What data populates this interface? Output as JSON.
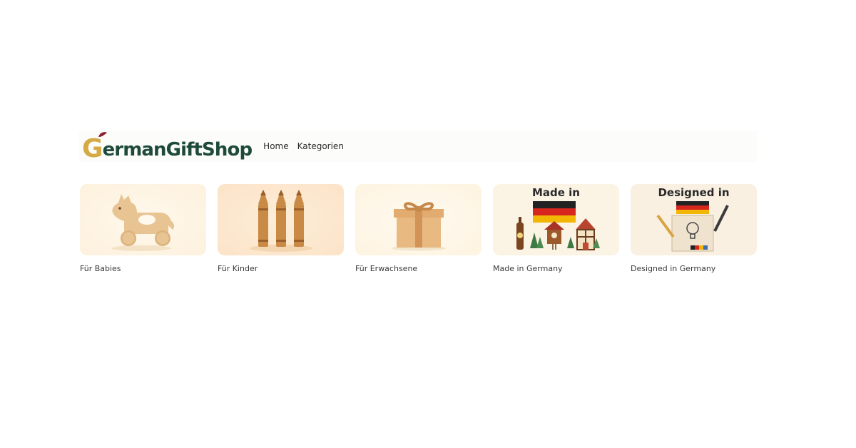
{
  "brand": {
    "logo_initial": "G",
    "logo_rest": "ermanGiftShop"
  },
  "nav": {
    "items": [
      "Home",
      "Kategorien"
    ]
  },
  "categories": [
    {
      "label": "Für Babies",
      "icon": "wooden-horse-icon"
    },
    {
      "label": "Für Kinder",
      "icon": "crayons-icon"
    },
    {
      "label": "Für Erwachsene",
      "icon": "gift-box-icon"
    },
    {
      "label": "Made in Germany",
      "image_title": "Made in",
      "icon": "made-in-germany-illustration"
    },
    {
      "label": "Designed in Germany",
      "image_title": "Designed in",
      "icon": "designed-in-germany-illustration"
    }
  ],
  "colors": {
    "logo_green": "#1d4a3a",
    "logo_gold": "#d4aa45",
    "logo_accent": "#8e1f2c",
    "flag_black": "#222222",
    "flag_red": "#d7261e",
    "flag_gold": "#f2b705"
  }
}
